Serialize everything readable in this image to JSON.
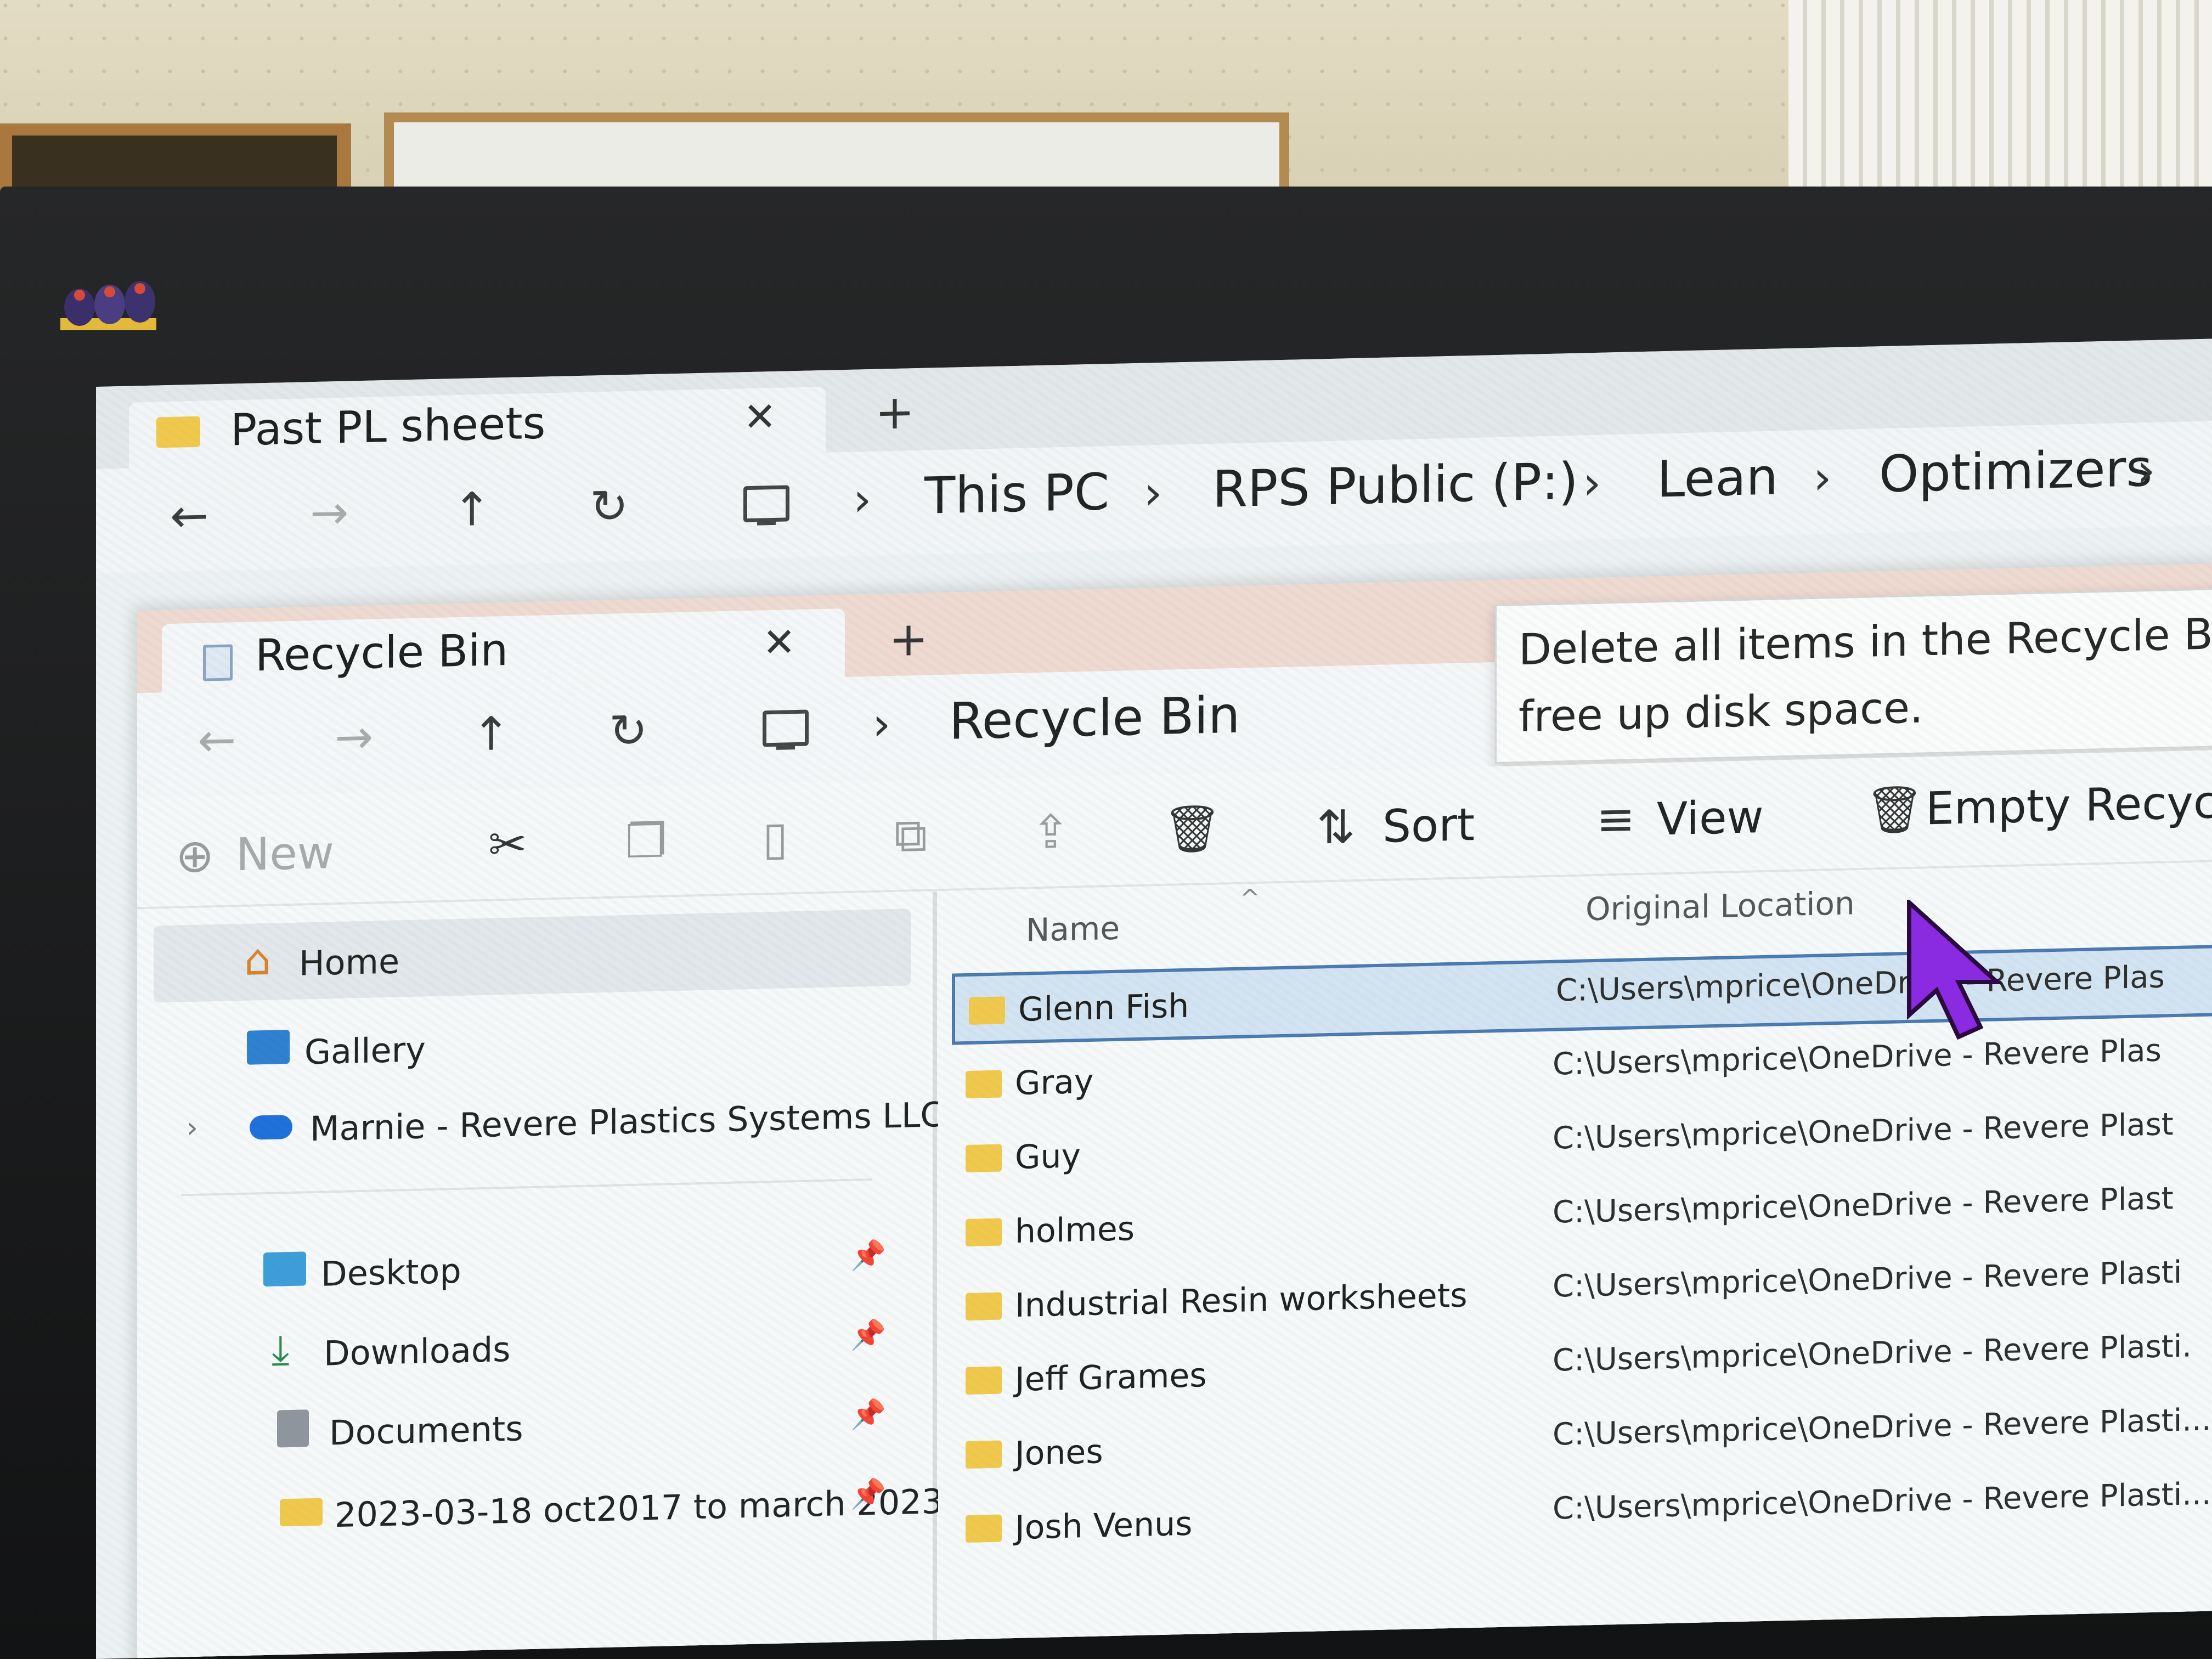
{
  "back_window": {
    "tab_title": "Past PL sheets",
    "close_glyph": "✕",
    "add_tab_glyph": "+",
    "breadcrumb": [
      "This PC",
      "RPS Public (P:)",
      "Lean",
      "Optimizers"
    ],
    "separator_glyph": "›"
  },
  "front_window": {
    "tab_title": "Recycle Bin",
    "close_glyph": "✕",
    "add_tab_glyph": "+",
    "breadcrumb": [
      "Recycle Bin"
    ],
    "separator_glyph": "›",
    "tooltip_lines": [
      "Delete all items in the Recycle Bir",
      "free up disk space."
    ]
  },
  "nav_glyphs": {
    "back": "←",
    "forward": "→",
    "up": "↑",
    "refresh": "↻"
  },
  "toolbar": {
    "new_label": "New",
    "sort_label": "Sort",
    "view_label": "View",
    "empty_label": "Empty Recycle",
    "icons": [
      "plus-circle-icon",
      "scissors-icon",
      "copy-icon",
      "paste-icon",
      "rename-icon",
      "share-icon",
      "delete-icon",
      "sort-icon",
      "view-icon",
      "empty-bin-icon"
    ]
  },
  "sidebar": {
    "items": [
      {
        "label": "Home",
        "icon": "home-icon"
      },
      {
        "label": "Gallery",
        "icon": "gallery-icon"
      },
      {
        "label": "Marnie - Revere Plastics Systems LLC",
        "icon": "onedrive-cloud-icon"
      },
      {
        "label": "Desktop",
        "icon": "desktop-icon"
      },
      {
        "label": "Downloads",
        "icon": "download-icon"
      },
      {
        "label": "Documents",
        "icon": "documents-icon"
      },
      {
        "label": "2023-03-18 oct2017 to march 2023",
        "icon": "folder-icon"
      }
    ]
  },
  "file_list": {
    "columns": {
      "name": "Name",
      "location": "Original Location"
    },
    "rows": [
      {
        "name": "Glenn Fish",
        "location": "C:\\Users\\mprice\\OneDrive - Revere Plas"
      },
      {
        "name": "Gray",
        "location": "C:\\Users\\mprice\\OneDrive - Revere Plas"
      },
      {
        "name": "Guy",
        "location": "C:\\Users\\mprice\\OneDrive - Revere Plast"
      },
      {
        "name": "holmes",
        "location": "C:\\Users\\mprice\\OneDrive - Revere Plast"
      },
      {
        "name": "Industrial Resin worksheets",
        "location": "C:\\Users\\mprice\\OneDrive - Revere Plasti"
      },
      {
        "name": "Jeff Grames",
        "location": "C:\\Users\\mprice\\OneDrive - Revere Plasti."
      },
      {
        "name": "Jones",
        "location": "C:\\Users\\mprice\\OneDrive - Revere Plasti..."
      },
      {
        "name": "Josh Venus",
        "location": "C:\\Users\\mprice\\OneDrive - Revere Plasti..."
      }
    ]
  },
  "colors": {
    "folder": "#f2c84b",
    "selection": "#d4e3f2",
    "selection_border": "#4a78b0",
    "cursor": "#8a2be2"
  }
}
